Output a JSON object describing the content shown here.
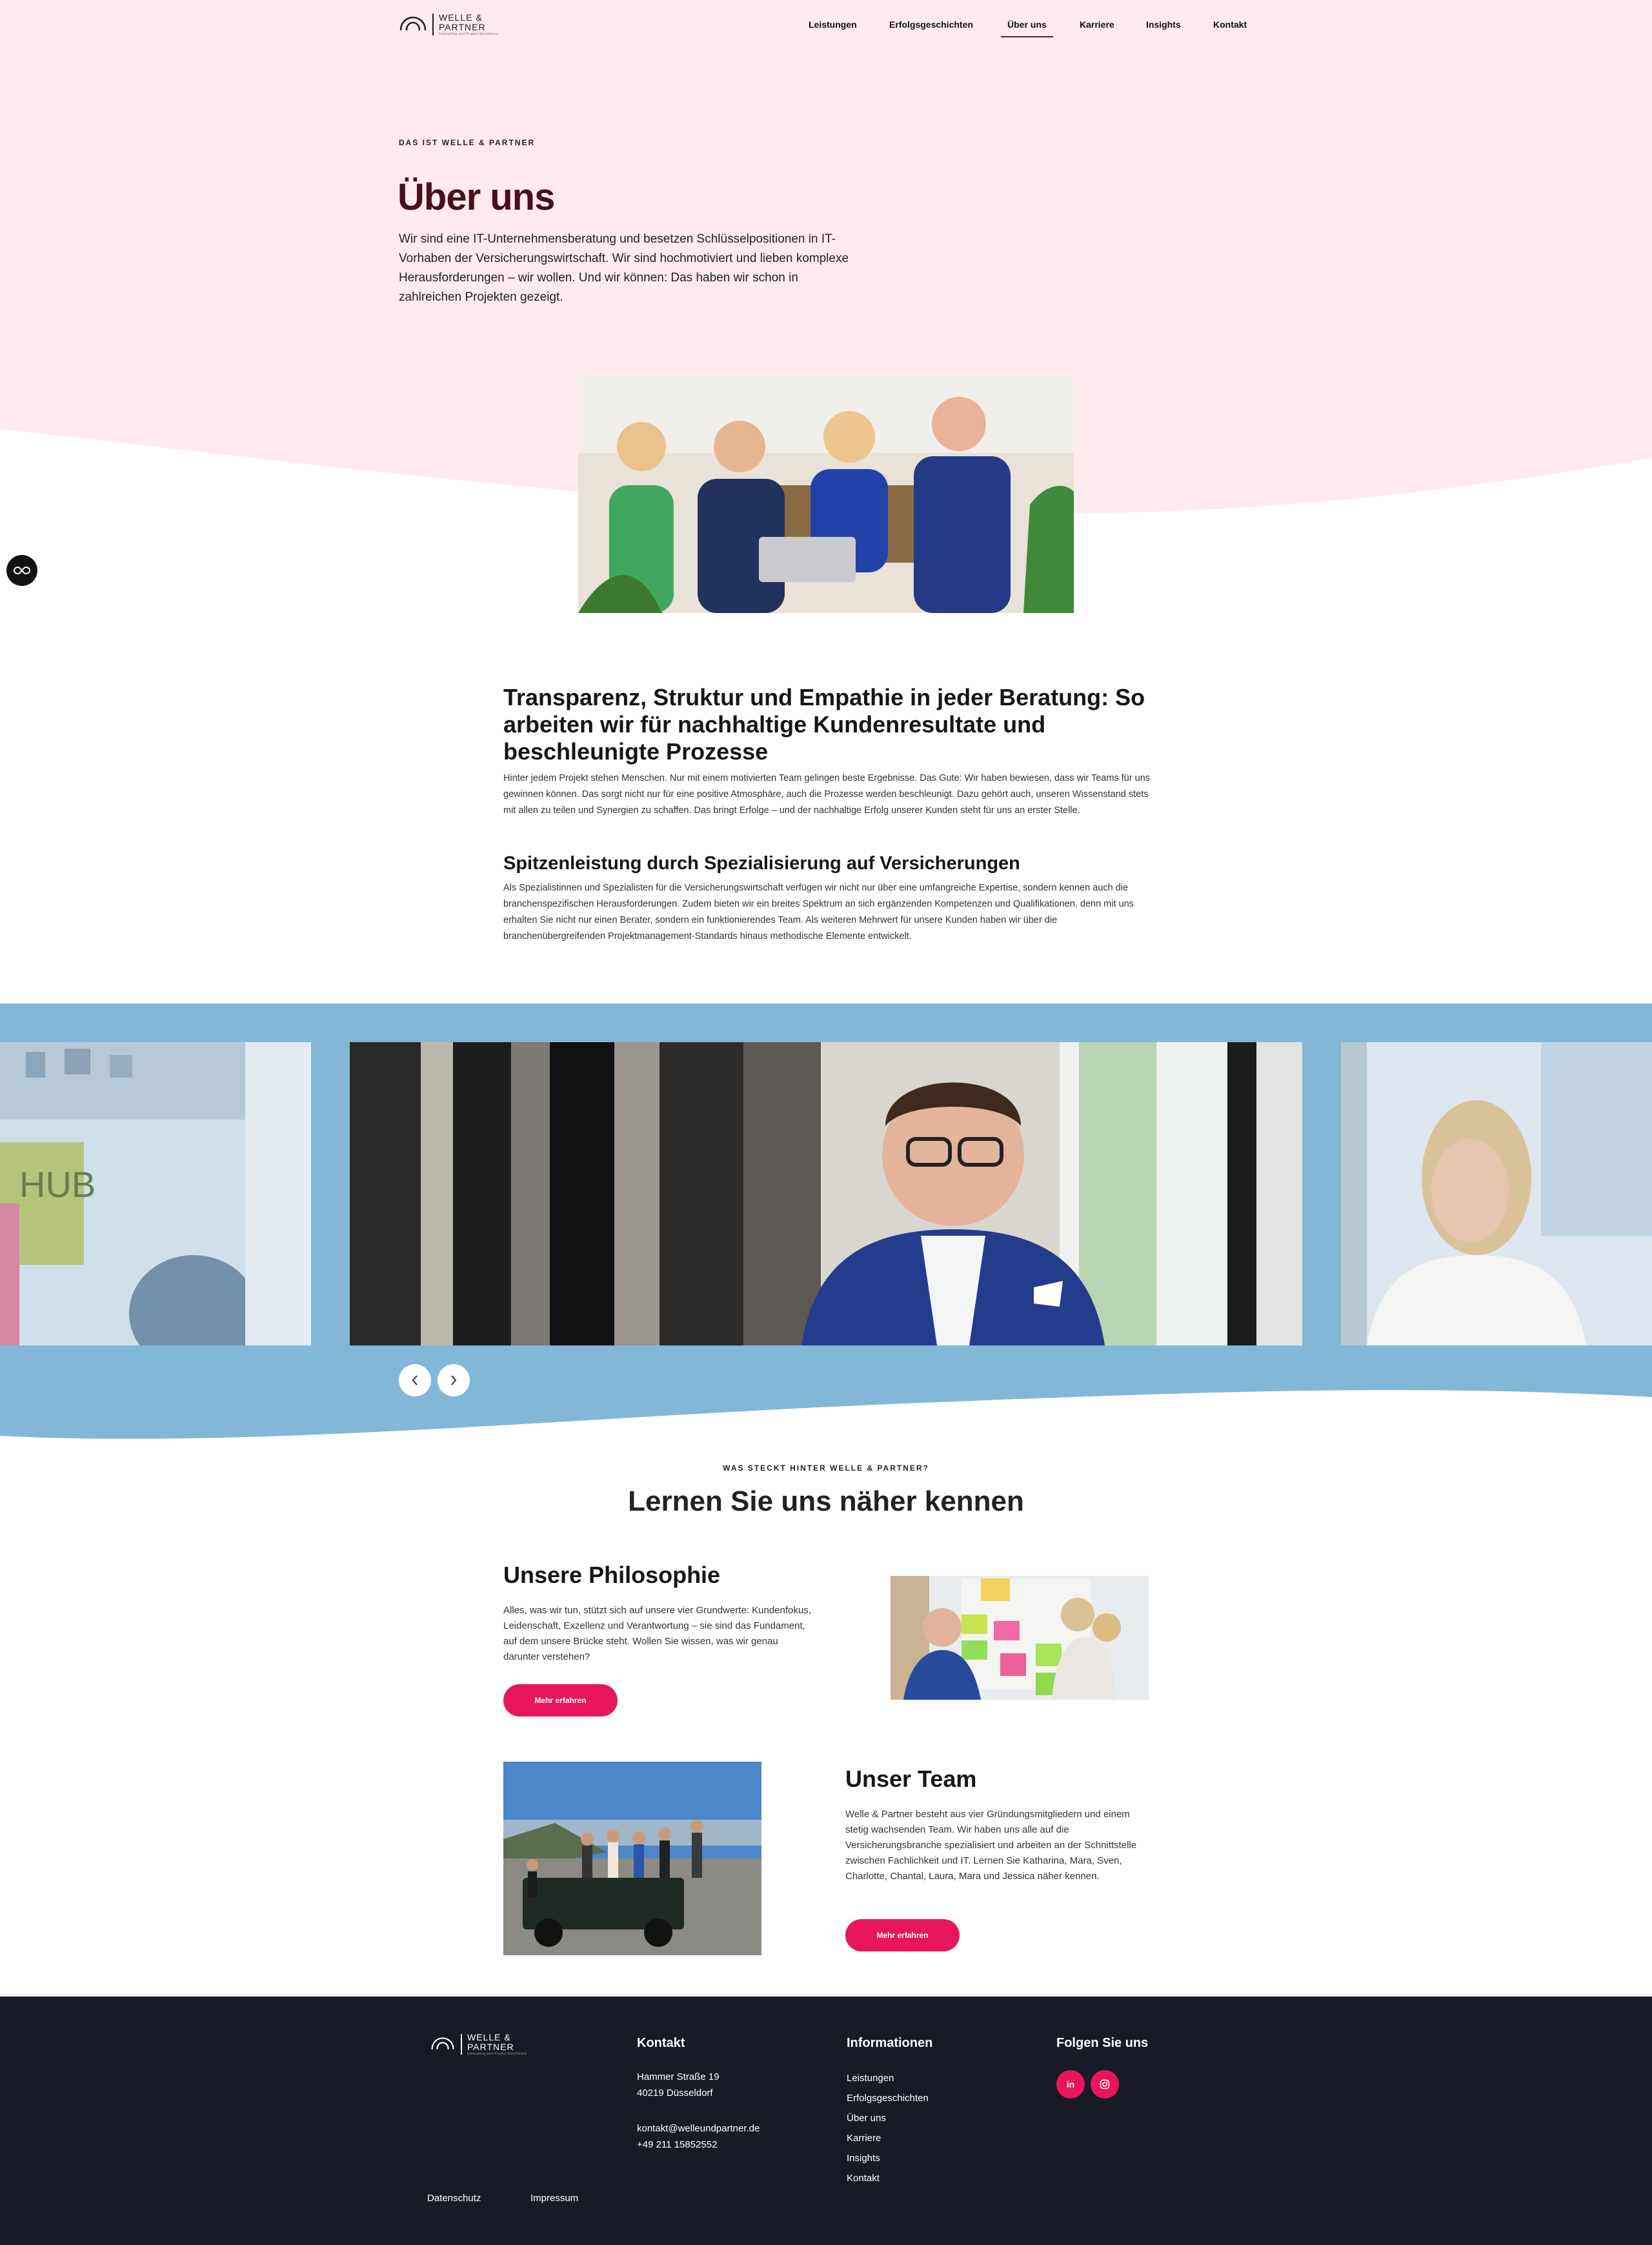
{
  "header": {
    "logo": {
      "line1": "WELLE &",
      "line2": "PARTNER",
      "tagline": "Consulting and Project Excellence"
    },
    "nav": [
      "Leistungen",
      "Erfolgsgeschichten",
      "Über uns",
      "Karriere",
      "Insights",
      "Kontakt"
    ],
    "active_nav": "Über uns"
  },
  "hero": {
    "eyebrow": "DAS IST WELLE & PARTNER",
    "title": "Über uns",
    "text": "Wir sind eine IT-Unternehmensberatung und besetzen Schlüsselpositionen in IT-Vorhaben der Versicherungswirtschaft. Wir sind hochmotiviert und lieben komplexe Herausforderungen – wir wollen. Und wir können: Das haben wir schon in zahlreichen Projekten gezeigt."
  },
  "float_button": {
    "icon": "infinity-icon"
  },
  "intro": {
    "heading": "Transparenz, Struktur und Empathie in jeder Beratung: So arbeiten wir für nachhaltige Kundenresultate und beschleunigte Prozesse",
    "text": "Hinter jedem Projekt stehen Menschen. Nur mit einem motivierten Team gelingen beste Ergebnisse. Das Gute: Wir haben bewiesen, dass wir Teams für uns gewinnen können. Das sorgt nicht nur für eine positive Atmosphäre, auch die Prozesse werden beschleunigt. Dazu gehört auch, unseren Wissenstand stets mit allen zu teilen und Synergien zu schaffen. Das bringt Erfolge – und der nachhaltige Erfolg unserer Kunden steht für uns an erster Stelle.",
    "subheading": "Spitzenleistung durch Spezialisierung auf Versicherungen",
    "subtext": "Als Spezialistinnen und Spezialisten für die Versicherungswirtschaft verfügen wir nicht nur über eine umfangreiche Expertise, sondern kennen auch die branchenspezifischen Herausforderungen. Zudem bieten wir ein breites Spektrum an sich ergänzenden Kompetenzen und Qualifikationen, denn mit uns erhalten Sie nicht nur einen Berater, sondern ein funktionierendes Team. Als weiteren Mehrwert für unsere Kunden haben wir über die branchenübergreifenden Projektmanagement-Standards hinaus methodische Elemente entwickelt."
  },
  "slider": {
    "prev_icon": "chevron-left-icon",
    "next_icon": "chevron-right-icon",
    "slide_text": "HUB"
  },
  "team_section": {
    "eyebrow": "WAS STECKT HINTER WELLE & PARTNER?",
    "title": "Lernen Sie uns näher kennen",
    "philosophy": {
      "title": "Unsere Philosophie",
      "text": "Alles, was wir tun, stützt sich auf unsere vier Grundwerte: Kundenfokus, Leidenschaft, Exzellenz und Verantwortung – sie sind das Fundament, auf dem unsere Brücke steht. Wollen Sie wissen, was wir genau darunter verstehen?",
      "button": "Mehr erfahren"
    },
    "team": {
      "title": "Unser Team",
      "text": "Welle & Partner besteht aus vier Gründungsmitgliedern und einem stetig wachsenden Team. Wir haben uns alle auf die Versicherungsbranche spezialisiert und arbeiten an der Schnittstelle zwischen Fachlichkeit und IT. Lernen Sie Katharina, Mara, Sven, Charlotte, Chantal, Laura, Mara und Jessica näher kennen.",
      "button": "Mehr erfahren"
    }
  },
  "footer": {
    "logo": {
      "line1": "WELLE &",
      "line2": "PARTNER",
      "tagline": "Consulting and Project Excellence"
    },
    "contact": {
      "title": "Kontakt",
      "street": "Hammer Straße 19",
      "city": "40219 Düsseldorf",
      "email": "kontakt@welleundpartner.de",
      "phone": "+49 211 15852552"
    },
    "info": {
      "title": "Informationen",
      "links": [
        "Leistungen",
        "Erfolgsgeschichten",
        "Über uns",
        "Karriere",
        "Insights",
        "Kontakt"
      ]
    },
    "social": {
      "title": "Folgen Sie uns",
      "linkedin": "in",
      "instagram_icon": "instagram-icon"
    },
    "legal": {
      "privacy": "Datenschutz",
      "imprint": "Impressum"
    }
  },
  "colors": {
    "hero_bg": "#ffeaf0",
    "slider_bg": "#82b7d8",
    "accent": "#e8155d",
    "title": "#4a0e1e",
    "footer_bg": "#161b26"
  }
}
